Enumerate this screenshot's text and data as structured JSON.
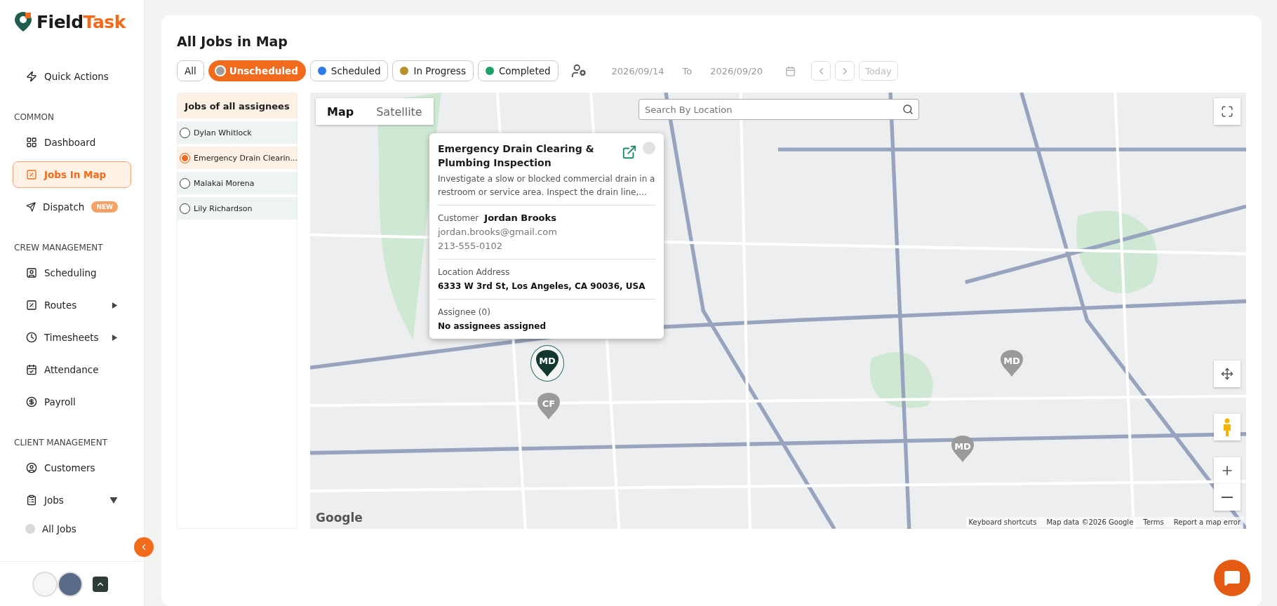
{
  "brand": {
    "first": "Field",
    "second": "Task"
  },
  "quick_action": "Quick Actions",
  "sections": [
    {
      "heading": "COMMON",
      "items": [
        {
          "label": "Dashboard",
          "selected": false
        },
        {
          "label": "Jobs In Map",
          "selected": true
        },
        {
          "label": "Dispatch",
          "selected": false,
          "badge": "NEW"
        }
      ]
    },
    {
      "heading": "CREW MANAGEMENT",
      "items": [
        {
          "label": "Scheduling",
          "selected": false
        },
        {
          "label": "Routes",
          "selected": false,
          "expanded": false
        },
        {
          "label": "Timesheets",
          "selected": false,
          "expanded": false
        },
        {
          "label": "Attendance",
          "selected": false
        },
        {
          "label": "Payroll",
          "selected": false
        }
      ]
    },
    {
      "heading": "CLIENT MANAGEMENT",
      "items": [
        {
          "label": "Customers",
          "selected": false
        },
        {
          "label": "Jobs",
          "selected": false,
          "expanded": true,
          "children": [
            {
              "label": "All Jobs"
            }
          ]
        }
      ]
    }
  ],
  "page_title": "All Jobs in Map",
  "filters": [
    {
      "label": "All",
      "selected": false
    },
    {
      "label": "Unscheduled",
      "selected": true,
      "color": "#9e9e9e"
    },
    {
      "label": "Scheduled",
      "selected": false,
      "color": "#2f7be6"
    },
    {
      "label": "In Progress",
      "selected": false,
      "color": "#b8902a"
    },
    {
      "label": "Completed",
      "selected": false,
      "color": "#1fa06a"
    }
  ],
  "date_from": "2026/09/14",
  "date_to_label": "To",
  "date_to": "2026/09/20",
  "today": "Today",
  "assignees": {
    "heading": "Jobs of all assignees",
    "items": [
      {
        "label": "Dylan Whitlock",
        "selected": false
      },
      {
        "label": "Emergency Drain Clearin...",
        "selected": true
      },
      {
        "label": "Malakai Morena",
        "selected": false
      },
      {
        "label": "Lily Richardson",
        "selected": false
      }
    ]
  },
  "map": {
    "tabs": [
      {
        "label": "Map",
        "selected": true
      },
      {
        "label": "Satellite",
        "selected": false
      }
    ],
    "search_placeholder": "Search By Location",
    "markers": [
      {
        "initials": "MD",
        "selected": true
      },
      {
        "initials": "CF",
        "selected": false
      },
      {
        "initials": "MD",
        "selected": false
      },
      {
        "initials": "MD",
        "selected": false
      }
    ],
    "popup": {
      "title": "Emergency Drain Clearing & Plumbing Inspection",
      "description": "Investigate a slow or blocked commercial drain in a restroom or service area. Inspect the drain line,...",
      "customer_label": "Customer",
      "customer_name": "Jordan Brooks",
      "email": "jordan.brooks@gmail.com",
      "phone": "213-555-0102",
      "address_label": "Location Address",
      "address": "6333 W 3rd St, Los Angeles, CA 90036, USA",
      "assignee_label": "Assignee (0)",
      "assignee_value": "No assignees assigned"
    },
    "logo": "Google",
    "attribution": [
      "Keyboard shortcuts",
      "Map data ©2026 Google",
      "Terms",
      "Report a map error"
    ]
  }
}
